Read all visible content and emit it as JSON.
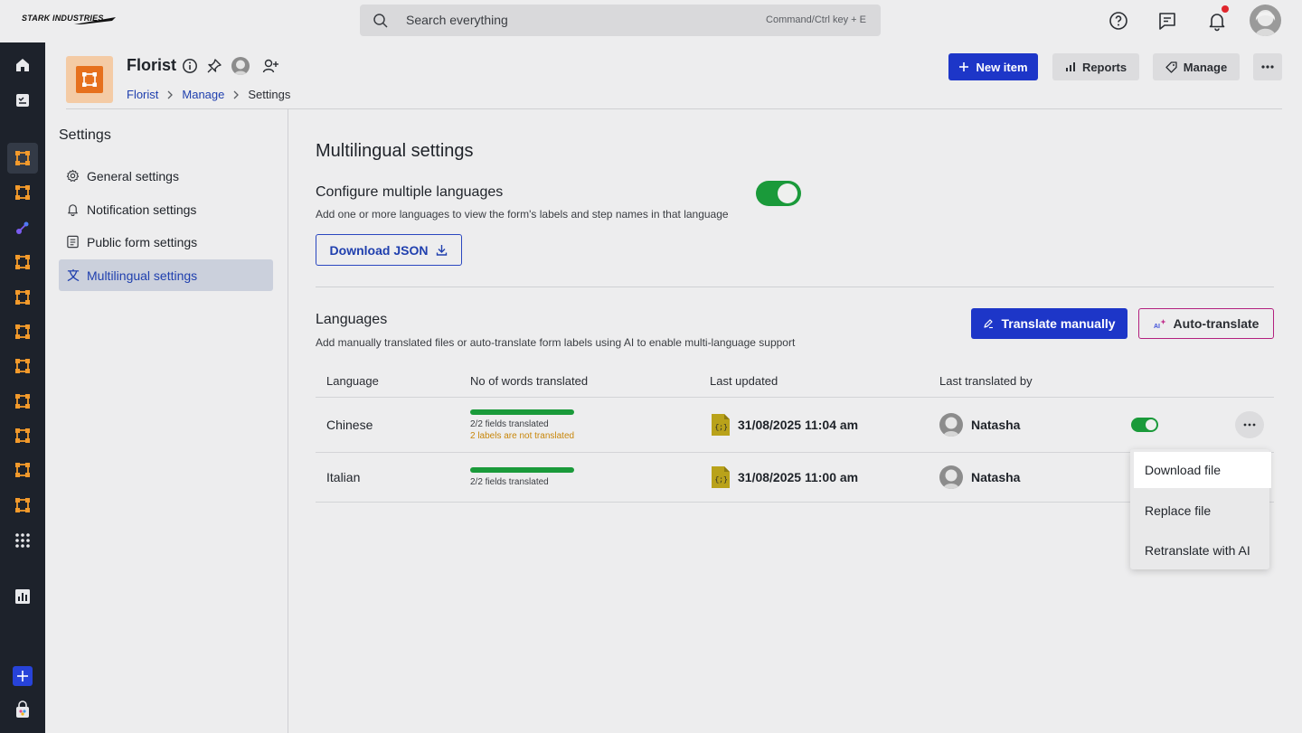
{
  "topbar": {
    "logo_text": "STARK INDUSTRIES",
    "search_placeholder": "Search everything",
    "search_shortcut": "Command/Ctrl key + E"
  },
  "header": {
    "app_name": "Florist",
    "breadcrumb": [
      "Florist",
      "Manage",
      "Settings"
    ],
    "buttons": {
      "new_item": "New item",
      "reports": "Reports",
      "manage": "Manage"
    }
  },
  "settings_nav": {
    "title": "Settings",
    "items": [
      {
        "label": "General settings",
        "icon": "gear-icon"
      },
      {
        "label": "Notification settings",
        "icon": "bell-icon"
      },
      {
        "label": "Public form settings",
        "icon": "form-icon"
      },
      {
        "label": "Multilingual settings",
        "icon": "translate-icon",
        "active": true
      }
    ]
  },
  "content": {
    "title": "Multilingual settings",
    "configure": {
      "title": "Configure multiple languages",
      "description": "Add one or more languages to view the form's labels and step names in that language",
      "enabled": true,
      "download_label": "Download JSON"
    },
    "languages": {
      "title": "Languages",
      "description": "Add manually translated files or auto-translate form labels using AI to enable multi-language support",
      "translate_manually": "Translate manually",
      "auto_translate": "Auto-translate",
      "columns": [
        "Language",
        "No of words translated",
        "Last updated",
        "Last translated by"
      ],
      "rows": [
        {
          "language": "Chinese",
          "progress": 1.0,
          "fields_text": "2/2 fields translated",
          "warning": "2 labels are not translated",
          "last_updated": "31/08/2025 11:04 am",
          "translated_by": "Natasha",
          "enabled": true
        },
        {
          "language": "Italian",
          "progress": 1.0,
          "fields_text": "2/2 fields translated",
          "warning": "",
          "last_updated": "31/08/2025 11:00 am",
          "translated_by": "Natasha",
          "enabled": true
        }
      ]
    }
  },
  "row_menu": {
    "items": [
      "Download file",
      "Replace file",
      "Retranslate with AI"
    ]
  },
  "colors": {
    "primary": "#1d36c8",
    "accent_orange": "#e6701d",
    "toggle_green": "#1a9a3a",
    "rail_bg": "#1d222b",
    "warning": "#c8860a"
  }
}
